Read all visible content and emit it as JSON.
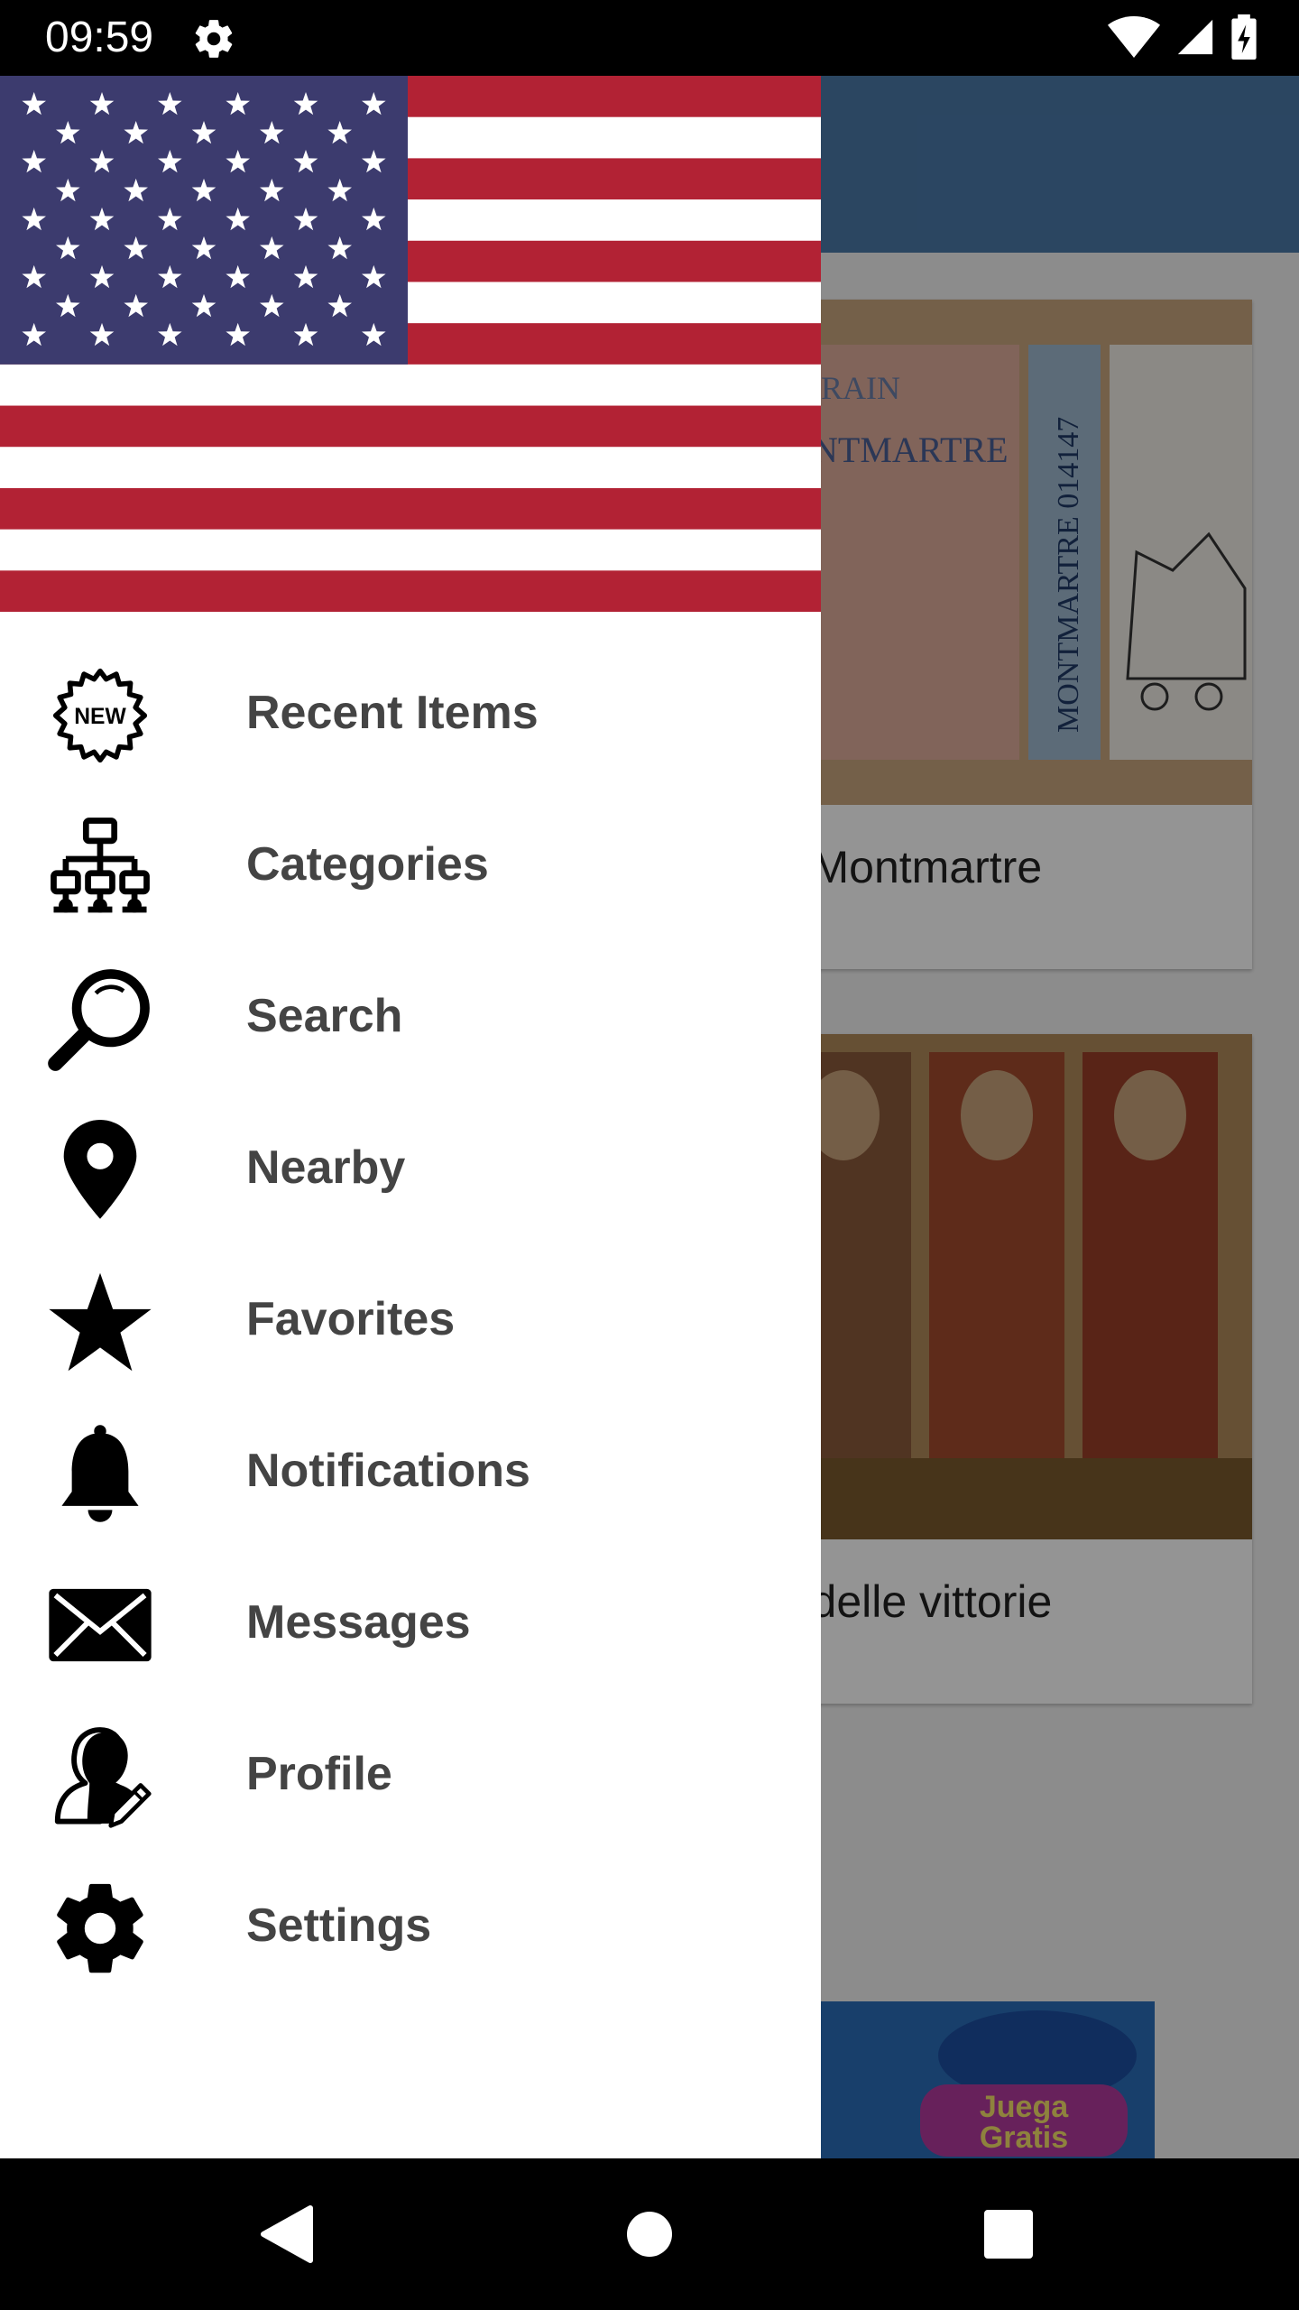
{
  "status_bar": {
    "time": "09:59",
    "icons": [
      "settings-icon",
      "wifi-icon",
      "signal-icon",
      "battery-icon"
    ]
  },
  "background_app": {
    "toolbar_color": "#4a79a8",
    "cards": [
      {
        "caption": "de Montmartre",
        "image": "montmartre-ticket-photo"
      },
      {
        "caption": "na delle vittorie",
        "image": "fresco-painting-photo"
      }
    ],
    "ad": {
      "text_line1": "Juega",
      "text_line2": "Gratis",
      "image": "fish-game-ad"
    }
  },
  "drawer": {
    "header_image": "us-flag",
    "items": [
      {
        "label": "Recent Items",
        "icon": "new-badge-icon"
      },
      {
        "label": "Categories",
        "icon": "hierarchy-icon"
      },
      {
        "label": "Search",
        "icon": "search-icon"
      },
      {
        "label": "Nearby",
        "icon": "location-pin-icon"
      },
      {
        "label": "Favorites",
        "icon": "star-icon"
      },
      {
        "label": "Notifications",
        "icon": "bell-icon"
      },
      {
        "label": "Messages",
        "icon": "envelope-icon"
      },
      {
        "label": "Profile",
        "icon": "profile-edit-icon"
      },
      {
        "label": "Settings",
        "icon": "gear-icon"
      }
    ],
    "new_badge_text": "NEW"
  },
  "nav_bar": {
    "buttons": [
      "back-icon",
      "home-icon",
      "recents-icon"
    ]
  },
  "colors": {
    "flag_red": "#b22234",
    "flag_blue": "#3c3b6e",
    "label_color": "#444444"
  }
}
